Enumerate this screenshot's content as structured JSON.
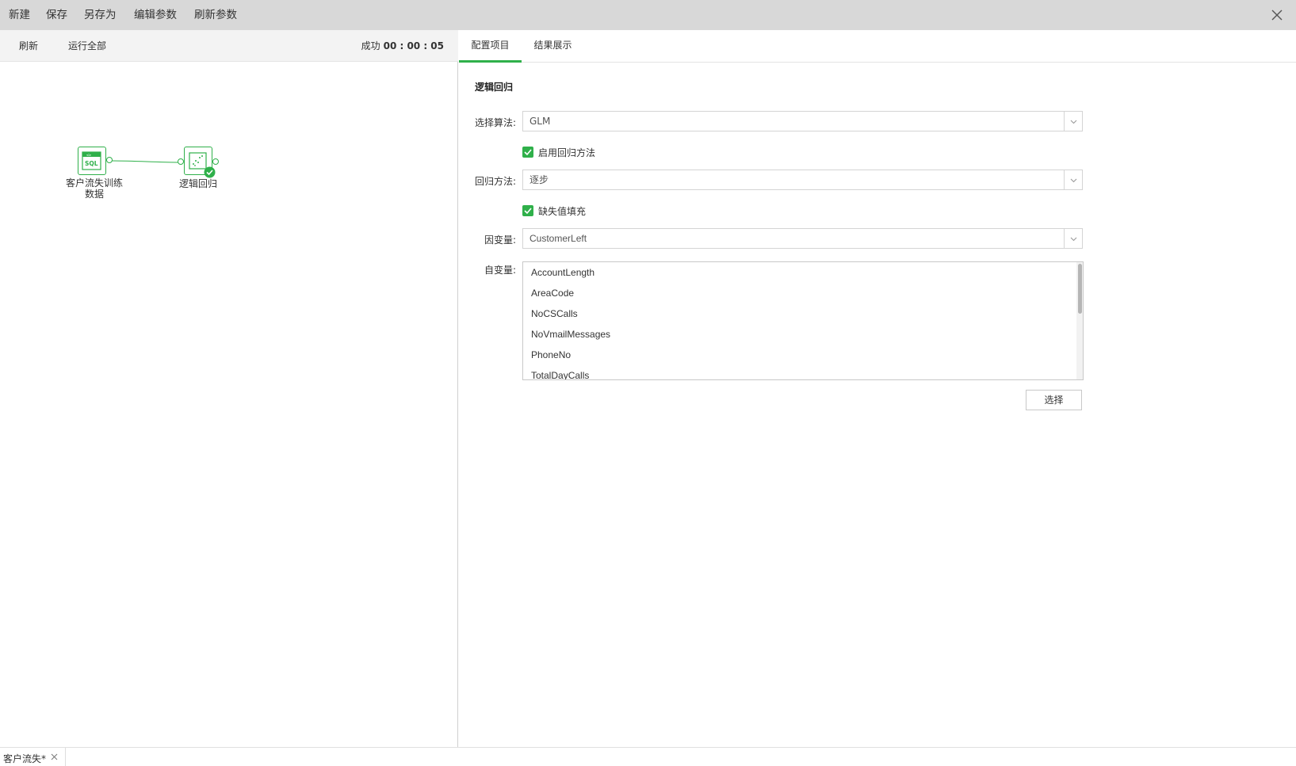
{
  "menubar": {
    "items": [
      "新建",
      "保存",
      "另存为",
      "编辑参数",
      "刷新参数"
    ],
    "close_icon": "close-icon"
  },
  "left_toolbar": {
    "refresh": "刷新",
    "run_all": "运行全部",
    "status_label": "成功",
    "status_time": "00 : 00 : 05"
  },
  "workflow": {
    "nodes": [
      {
        "label_line1": "客户流失训练",
        "label_line2": "数据",
        "icon": "sql-icon"
      },
      {
        "label_line1": "逻辑回归",
        "icon": "scatter-icon",
        "status_icon": "check-circle-icon"
      }
    ]
  },
  "tabs": [
    "配置项目",
    "结果展示"
  ],
  "config": {
    "title": "逻辑回归",
    "algorithm_label": "选择算法:",
    "algorithm_value": "GLM",
    "enable_regression_label": "启用回归方法",
    "regression_method_label": "回归方法:",
    "regression_method_value": "逐步",
    "missing_fill_label": "缺失值填充",
    "dependent_label": "因变量:",
    "dependent_value": "CustomerLeft",
    "independent_label": "自变量:",
    "independent_items": [
      "AccountLength",
      "AreaCode",
      "NoCSCalls",
      "NoVmailMessages",
      "PhoneNo",
      "TotalDayCalls"
    ],
    "select_button": "选择"
  },
  "bottom_tabs": [
    {
      "name": "客户流失*"
    }
  ],
  "colors": {
    "accent": "#2fb04a",
    "topbar": "#d8d8d8"
  }
}
